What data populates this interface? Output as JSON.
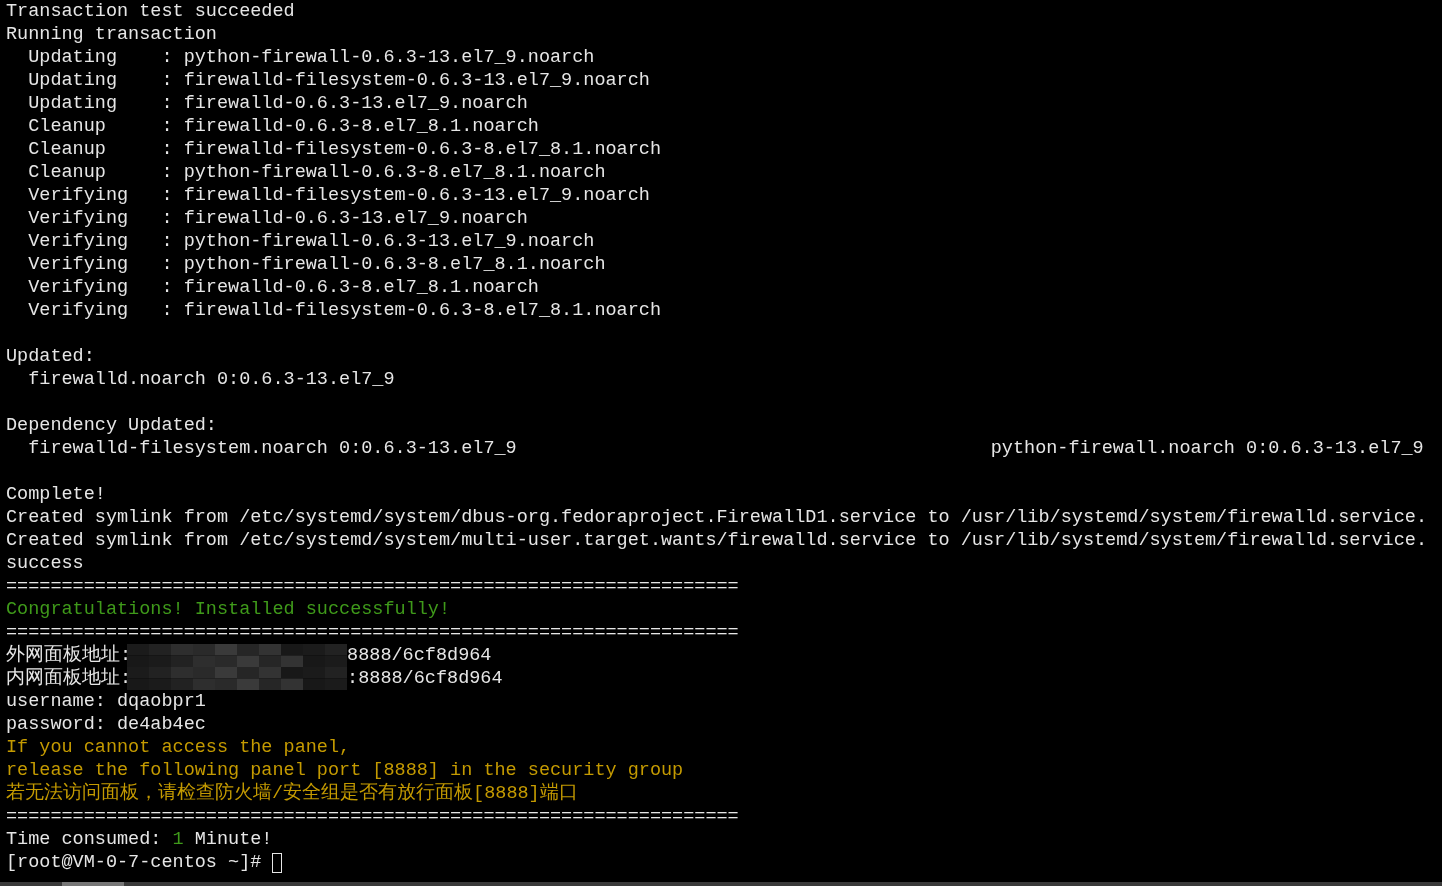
{
  "terminal": {
    "lines": [
      {
        "kind": "text",
        "segments": [
          {
            "text": "Transaction test succeeded",
            "kind": "output"
          }
        ]
      },
      {
        "kind": "text",
        "segments": [
          {
            "text": "Running transaction",
            "kind": "output"
          }
        ]
      },
      {
        "kind": "text",
        "segments": [
          {
            "text": "  Updating    : python-firewall-0.6.3-13.el7_9.noarch",
            "kind": "output"
          }
        ]
      },
      {
        "kind": "text",
        "segments": [
          {
            "text": "  Updating    : firewalld-filesystem-0.6.3-13.el7_9.noarch",
            "kind": "output"
          }
        ]
      },
      {
        "kind": "text",
        "segments": [
          {
            "text": "  Updating    : firewalld-0.6.3-13.el7_9.noarch",
            "kind": "output"
          }
        ]
      },
      {
        "kind": "text",
        "segments": [
          {
            "text": "  Cleanup     : firewalld-0.6.3-8.el7_8.1.noarch",
            "kind": "output"
          }
        ]
      },
      {
        "kind": "text",
        "segments": [
          {
            "text": "  Cleanup     : firewalld-filesystem-0.6.3-8.el7_8.1.noarch",
            "kind": "output"
          }
        ]
      },
      {
        "kind": "text",
        "segments": [
          {
            "text": "  Cleanup     : python-firewall-0.6.3-8.el7_8.1.noarch",
            "kind": "output"
          }
        ]
      },
      {
        "kind": "text",
        "segments": [
          {
            "text": "  Verifying   : firewalld-filesystem-0.6.3-13.el7_9.noarch",
            "kind": "output"
          }
        ]
      },
      {
        "kind": "text",
        "segments": [
          {
            "text": "  Verifying   : firewalld-0.6.3-13.el7_9.noarch",
            "kind": "output"
          }
        ]
      },
      {
        "kind": "text",
        "segments": [
          {
            "text": "  Verifying   : python-firewall-0.6.3-13.el7_9.noarch",
            "kind": "output"
          }
        ]
      },
      {
        "kind": "text",
        "segments": [
          {
            "text": "  Verifying   : python-firewall-0.6.3-8.el7_8.1.noarch",
            "kind": "output"
          }
        ]
      },
      {
        "kind": "text",
        "segments": [
          {
            "text": "  Verifying   : firewalld-0.6.3-8.el7_8.1.noarch",
            "kind": "output"
          }
        ]
      },
      {
        "kind": "text",
        "segments": [
          {
            "text": "  Verifying   : firewalld-filesystem-0.6.3-8.el7_8.1.noarch",
            "kind": "output"
          }
        ]
      },
      {
        "kind": "blank"
      },
      {
        "kind": "text",
        "segments": [
          {
            "text": "Updated:",
            "kind": "output"
          }
        ]
      },
      {
        "kind": "text",
        "segments": [
          {
            "text": "  firewalld.noarch 0:0.6.3-13.el7_9",
            "kind": "output"
          }
        ]
      },
      {
        "kind": "blank"
      },
      {
        "kind": "text",
        "segments": [
          {
            "text": "Dependency Updated:",
            "kind": "output"
          }
        ]
      },
      {
        "kind": "columns",
        "segments": [
          {
            "text": "  firewalld-filesystem.noarch 0:0.6.3-13.el7_9",
            "kind": "output"
          },
          {
            "text": "python-firewall.noarch 0:0.6.3-13.el7_9",
            "kind": "output"
          }
        ]
      },
      {
        "kind": "blank"
      },
      {
        "kind": "text",
        "segments": [
          {
            "text": "Complete!",
            "kind": "output"
          }
        ]
      },
      {
        "kind": "text",
        "segments": [
          {
            "text": "Created symlink from /etc/systemd/system/dbus-org.fedoraproject.FirewallD1.service to /usr/lib/systemd/system/firewalld.service.",
            "kind": "output"
          }
        ]
      },
      {
        "kind": "text",
        "segments": [
          {
            "text": "Created symlink from /etc/systemd/system/multi-user.target.wants/firewalld.service to /usr/lib/systemd/system/firewalld.service.",
            "kind": "output"
          }
        ]
      },
      {
        "kind": "text",
        "segments": [
          {
            "text": "success",
            "kind": "output"
          }
        ]
      },
      {
        "kind": "text",
        "segments": [
          {
            "text": "==================================================================",
            "kind": "output"
          }
        ]
      },
      {
        "kind": "text",
        "segments": [
          {
            "text": "Congratulations! Installed successfully!",
            "kind": "success"
          }
        ]
      },
      {
        "kind": "text",
        "segments": [
          {
            "text": "==================================================================",
            "kind": "output"
          }
        ]
      },
      {
        "kind": "redacted",
        "segments": [
          {
            "text": "外网面板地址:",
            "kind": "output"
          },
          {
            "text": "8888/6cf8d964",
            "kind": "output"
          }
        ]
      },
      {
        "kind": "redacted",
        "segments": [
          {
            "text": "内网面板地址:",
            "kind": "output"
          },
          {
            "text": ":8888/6cf8d964",
            "kind": "output"
          }
        ]
      },
      {
        "kind": "text",
        "segments": [
          {
            "text": "username: dqaobpr1",
            "kind": "output"
          }
        ]
      },
      {
        "kind": "text",
        "segments": [
          {
            "text": "password: de4ab4ec",
            "kind": "output"
          }
        ]
      },
      {
        "kind": "text",
        "segments": [
          {
            "text": "If you cannot access the panel,",
            "kind": "warning"
          }
        ]
      },
      {
        "kind": "text",
        "segments": [
          {
            "text": "release the following panel port [8888] in the security group",
            "kind": "warning"
          }
        ]
      },
      {
        "kind": "text",
        "segments": [
          {
            "text": "若无法访问面板，请检查防火墙/安全组是否有放行面板[8888]端口",
            "kind": "warning"
          }
        ]
      },
      {
        "kind": "text",
        "segments": [
          {
            "text": "==================================================================",
            "kind": "output"
          }
        ]
      },
      {
        "kind": "text",
        "segments": [
          {
            "text": "Time consumed: ",
            "kind": "output"
          },
          {
            "text": "1",
            "kind": "success"
          },
          {
            "text": " Minute!",
            "kind": "output"
          }
        ]
      },
      {
        "kind": "prompt",
        "segments": [
          {
            "text": "[root@VM-0-7-centos ~]# ",
            "kind": "output"
          }
        ]
      }
    ]
  }
}
